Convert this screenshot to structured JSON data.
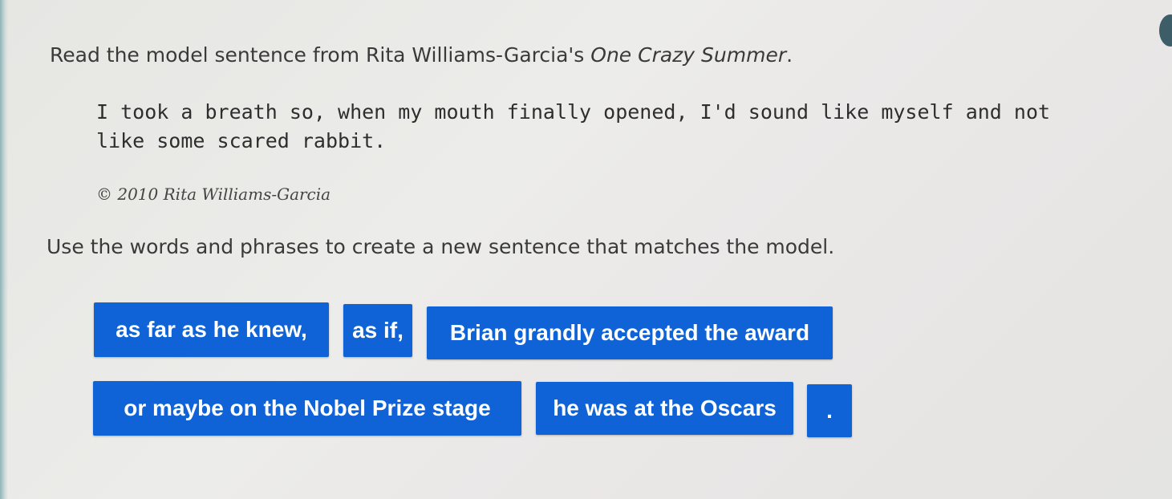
{
  "prompt": {
    "prefix": "Read the model sentence from Rita Williams-Garcia's ",
    "book_title": "One Crazy Summer",
    "suffix": "."
  },
  "quote": {
    "text": "I took a breath so, when my mouth finally opened, I'd sound like myself and not like some scared rabbit."
  },
  "copyright": {
    "text": "© 2010 Rita Williams-Garcia"
  },
  "instruction": {
    "text": "Use the words and phrases to create a new sentence that matches the model."
  },
  "tiles": [
    {
      "label": "as far as he knew,"
    },
    {
      "label": "as if,"
    },
    {
      "label": "Brian grandly accepted the award"
    },
    {
      "label": "or maybe on the Nobel Prize stage"
    },
    {
      "label": "he was at the Oscars"
    },
    {
      "label": "."
    }
  ],
  "colors": {
    "tile_background": "#0f63d6",
    "tile_text": "#ffffff"
  }
}
